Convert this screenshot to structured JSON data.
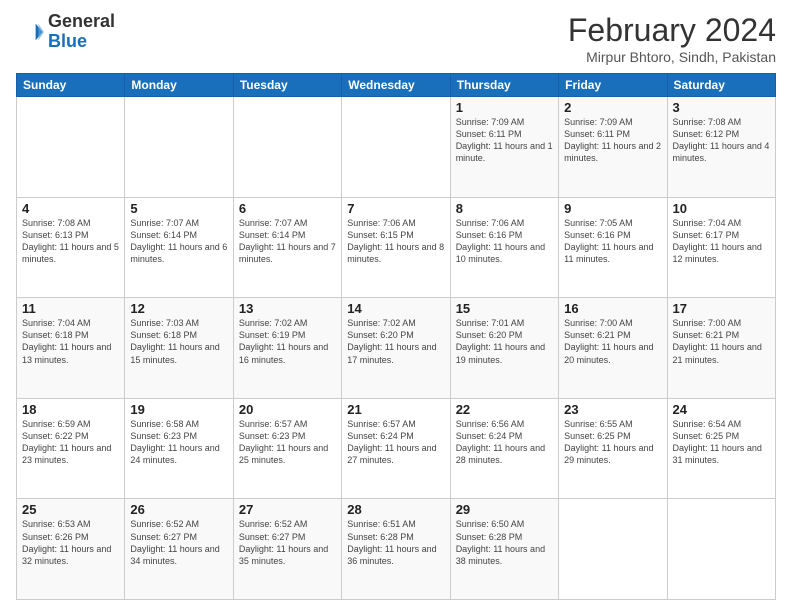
{
  "header": {
    "logo_line1": "General",
    "logo_line2": "Blue",
    "title": "February 2024",
    "subtitle": "Mirpur Bhtoro, Sindh, Pakistan"
  },
  "days_of_week": [
    "Sunday",
    "Monday",
    "Tuesday",
    "Wednesday",
    "Thursday",
    "Friday",
    "Saturday"
  ],
  "weeks": [
    [
      {
        "num": "",
        "info": ""
      },
      {
        "num": "",
        "info": ""
      },
      {
        "num": "",
        "info": ""
      },
      {
        "num": "",
        "info": ""
      },
      {
        "num": "1",
        "info": "Sunrise: 7:09 AM\nSunset: 6:11 PM\nDaylight: 11 hours and 1 minute."
      },
      {
        "num": "2",
        "info": "Sunrise: 7:09 AM\nSunset: 6:11 PM\nDaylight: 11 hours and 2 minutes."
      },
      {
        "num": "3",
        "info": "Sunrise: 7:08 AM\nSunset: 6:12 PM\nDaylight: 11 hours and 4 minutes."
      }
    ],
    [
      {
        "num": "4",
        "info": "Sunrise: 7:08 AM\nSunset: 6:13 PM\nDaylight: 11 hours and 5 minutes."
      },
      {
        "num": "5",
        "info": "Sunrise: 7:07 AM\nSunset: 6:14 PM\nDaylight: 11 hours and 6 minutes."
      },
      {
        "num": "6",
        "info": "Sunrise: 7:07 AM\nSunset: 6:14 PM\nDaylight: 11 hours and 7 minutes."
      },
      {
        "num": "7",
        "info": "Sunrise: 7:06 AM\nSunset: 6:15 PM\nDaylight: 11 hours and 8 minutes."
      },
      {
        "num": "8",
        "info": "Sunrise: 7:06 AM\nSunset: 6:16 PM\nDaylight: 11 hours and 10 minutes."
      },
      {
        "num": "9",
        "info": "Sunrise: 7:05 AM\nSunset: 6:16 PM\nDaylight: 11 hours and 11 minutes."
      },
      {
        "num": "10",
        "info": "Sunrise: 7:04 AM\nSunset: 6:17 PM\nDaylight: 11 hours and 12 minutes."
      }
    ],
    [
      {
        "num": "11",
        "info": "Sunrise: 7:04 AM\nSunset: 6:18 PM\nDaylight: 11 hours and 13 minutes."
      },
      {
        "num": "12",
        "info": "Sunrise: 7:03 AM\nSunset: 6:18 PM\nDaylight: 11 hours and 15 minutes."
      },
      {
        "num": "13",
        "info": "Sunrise: 7:02 AM\nSunset: 6:19 PM\nDaylight: 11 hours and 16 minutes."
      },
      {
        "num": "14",
        "info": "Sunrise: 7:02 AM\nSunset: 6:20 PM\nDaylight: 11 hours and 17 minutes."
      },
      {
        "num": "15",
        "info": "Sunrise: 7:01 AM\nSunset: 6:20 PM\nDaylight: 11 hours and 19 minutes."
      },
      {
        "num": "16",
        "info": "Sunrise: 7:00 AM\nSunset: 6:21 PM\nDaylight: 11 hours and 20 minutes."
      },
      {
        "num": "17",
        "info": "Sunrise: 7:00 AM\nSunset: 6:21 PM\nDaylight: 11 hours and 21 minutes."
      }
    ],
    [
      {
        "num": "18",
        "info": "Sunrise: 6:59 AM\nSunset: 6:22 PM\nDaylight: 11 hours and 23 minutes."
      },
      {
        "num": "19",
        "info": "Sunrise: 6:58 AM\nSunset: 6:23 PM\nDaylight: 11 hours and 24 minutes."
      },
      {
        "num": "20",
        "info": "Sunrise: 6:57 AM\nSunset: 6:23 PM\nDaylight: 11 hours and 25 minutes."
      },
      {
        "num": "21",
        "info": "Sunrise: 6:57 AM\nSunset: 6:24 PM\nDaylight: 11 hours and 27 minutes."
      },
      {
        "num": "22",
        "info": "Sunrise: 6:56 AM\nSunset: 6:24 PM\nDaylight: 11 hours and 28 minutes."
      },
      {
        "num": "23",
        "info": "Sunrise: 6:55 AM\nSunset: 6:25 PM\nDaylight: 11 hours and 29 minutes."
      },
      {
        "num": "24",
        "info": "Sunrise: 6:54 AM\nSunset: 6:25 PM\nDaylight: 11 hours and 31 minutes."
      }
    ],
    [
      {
        "num": "25",
        "info": "Sunrise: 6:53 AM\nSunset: 6:26 PM\nDaylight: 11 hours and 32 minutes."
      },
      {
        "num": "26",
        "info": "Sunrise: 6:52 AM\nSunset: 6:27 PM\nDaylight: 11 hours and 34 minutes."
      },
      {
        "num": "27",
        "info": "Sunrise: 6:52 AM\nSunset: 6:27 PM\nDaylight: 11 hours and 35 minutes."
      },
      {
        "num": "28",
        "info": "Sunrise: 6:51 AM\nSunset: 6:28 PM\nDaylight: 11 hours and 36 minutes."
      },
      {
        "num": "29",
        "info": "Sunrise: 6:50 AM\nSunset: 6:28 PM\nDaylight: 11 hours and 38 minutes."
      },
      {
        "num": "",
        "info": ""
      },
      {
        "num": "",
        "info": ""
      }
    ]
  ]
}
